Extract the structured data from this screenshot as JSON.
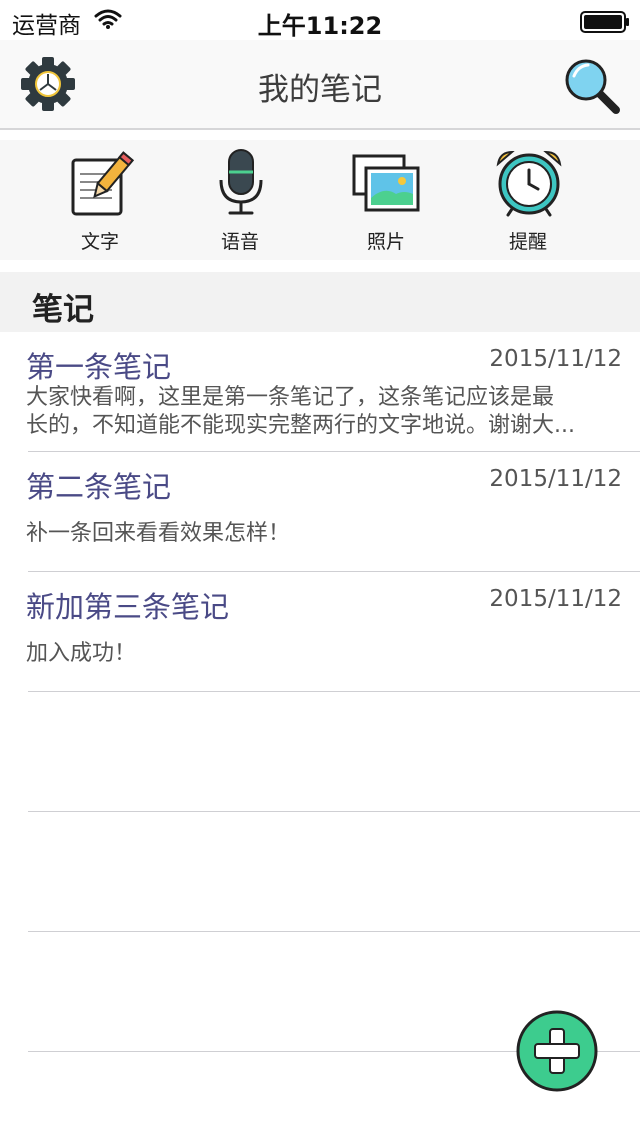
{
  "status_bar": {
    "carrier": "运营商",
    "time": "上午11:22"
  },
  "nav": {
    "title": "我的笔记"
  },
  "toolbar": [
    {
      "label": "文字",
      "icon": "notepad-pencil-icon"
    },
    {
      "label": "语音",
      "icon": "microphone-icon"
    },
    {
      "label": "照片",
      "icon": "photos-icon"
    },
    {
      "label": "提醒",
      "icon": "alarm-clock-icon"
    }
  ],
  "section": {
    "title": "笔记"
  },
  "notes": [
    {
      "title": "第一条笔记",
      "date": "2015/11/12",
      "body_line1": "大家快看啊，这里是第一条笔记了，这条笔记应该是最",
      "body_line2": "长的，不知道能不能现实完整两行的文字地说。谢谢大..."
    },
    {
      "title": "第二条笔记",
      "date": "2015/11/12",
      "body": "补一条回来看看效果怎样！"
    },
    {
      "title": "新加第三条笔记",
      "date": "2015/11/12",
      "body": "加入成功！"
    }
  ],
  "colors": {
    "accent_title": "#4a4a86",
    "fab": "#3dcc8e",
    "nav_bg": "#f9f9f9"
  }
}
